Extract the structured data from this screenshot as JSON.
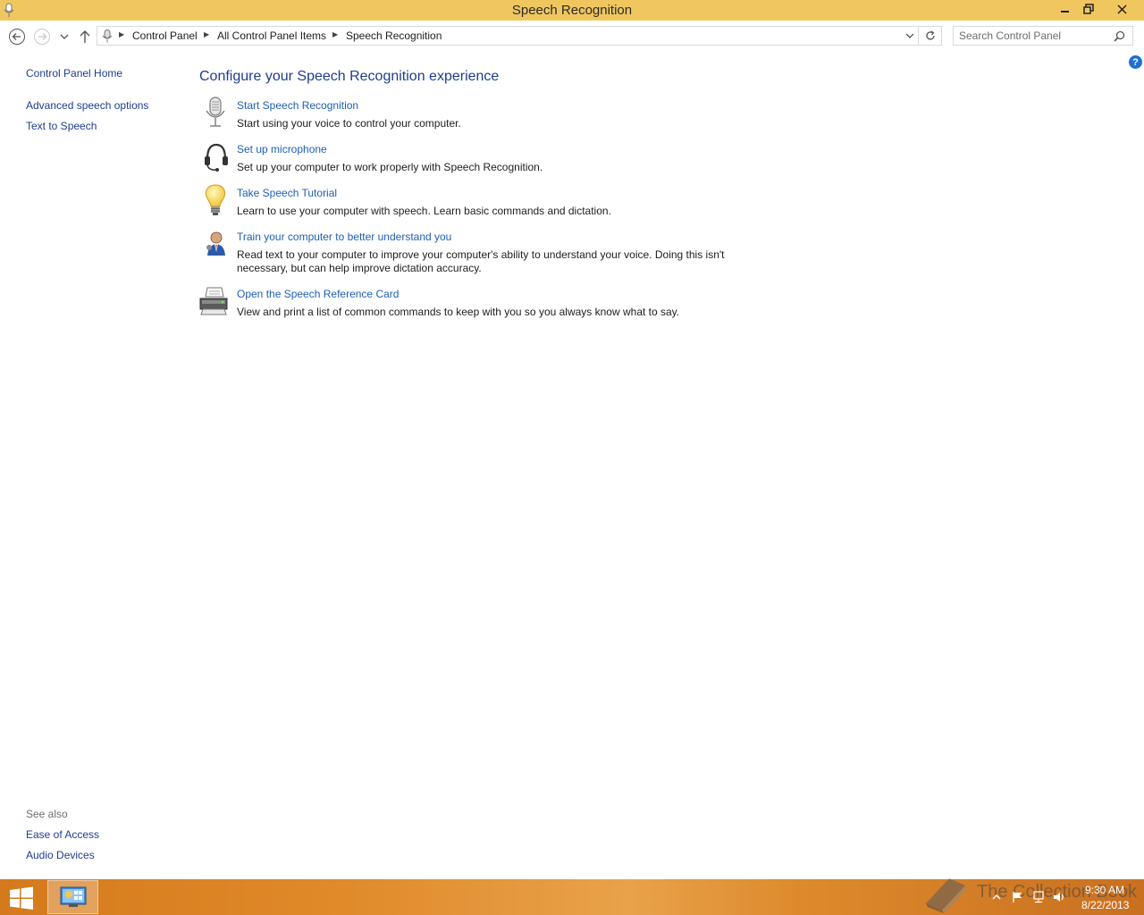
{
  "window": {
    "title": "Speech Recognition",
    "minimize_label": "—",
    "maximize_label": "❐",
    "close_label": "✕"
  },
  "address": {
    "breadcrumbs": [
      "Control Panel",
      "All Control Panel Items",
      "Speech Recognition"
    ],
    "icon": "microphone-icon"
  },
  "search": {
    "placeholder": "Search Control Panel"
  },
  "left_pane": {
    "home": "Control Panel Home",
    "links": [
      "Advanced speech options",
      "Text to Speech"
    ],
    "see_also_label": "See also",
    "see_also": [
      "Ease of Access",
      "Audio Devices"
    ]
  },
  "main": {
    "heading": "Configure your Speech Recognition experience",
    "tasks": [
      {
        "icon": "microphone-icon",
        "title": "Start Speech Recognition",
        "desc": "Start using your voice to control your computer."
      },
      {
        "icon": "headset-icon",
        "title": "Set up microphone",
        "desc": "Set up your computer to work properly with Speech Recognition."
      },
      {
        "icon": "lightbulb-icon",
        "title": "Take Speech Tutorial",
        "desc": "Learn to use your computer with speech.  Learn basic commands and dictation."
      },
      {
        "icon": "person-icon",
        "title": "Train your computer to better understand you",
        "desc": "Read text to your computer to improve your computer's ability to understand your voice.  Doing this isn't necessary, but can help improve dictation accuracy."
      },
      {
        "icon": "printer-icon",
        "title": "Open the Speech Reference Card",
        "desc": "View and print a list of common commands to keep with you so you always know what to say."
      }
    ]
  },
  "help": "?",
  "taskbar": {
    "watermark": "The Collection Book",
    "time": "9:30 AM",
    "date": "8/22/2013"
  },
  "colors": {
    "titlebar": "#f0c75e",
    "link": "#1e5fb4",
    "heading": "#1e3d8f",
    "taskbar": "#e08a2a"
  }
}
